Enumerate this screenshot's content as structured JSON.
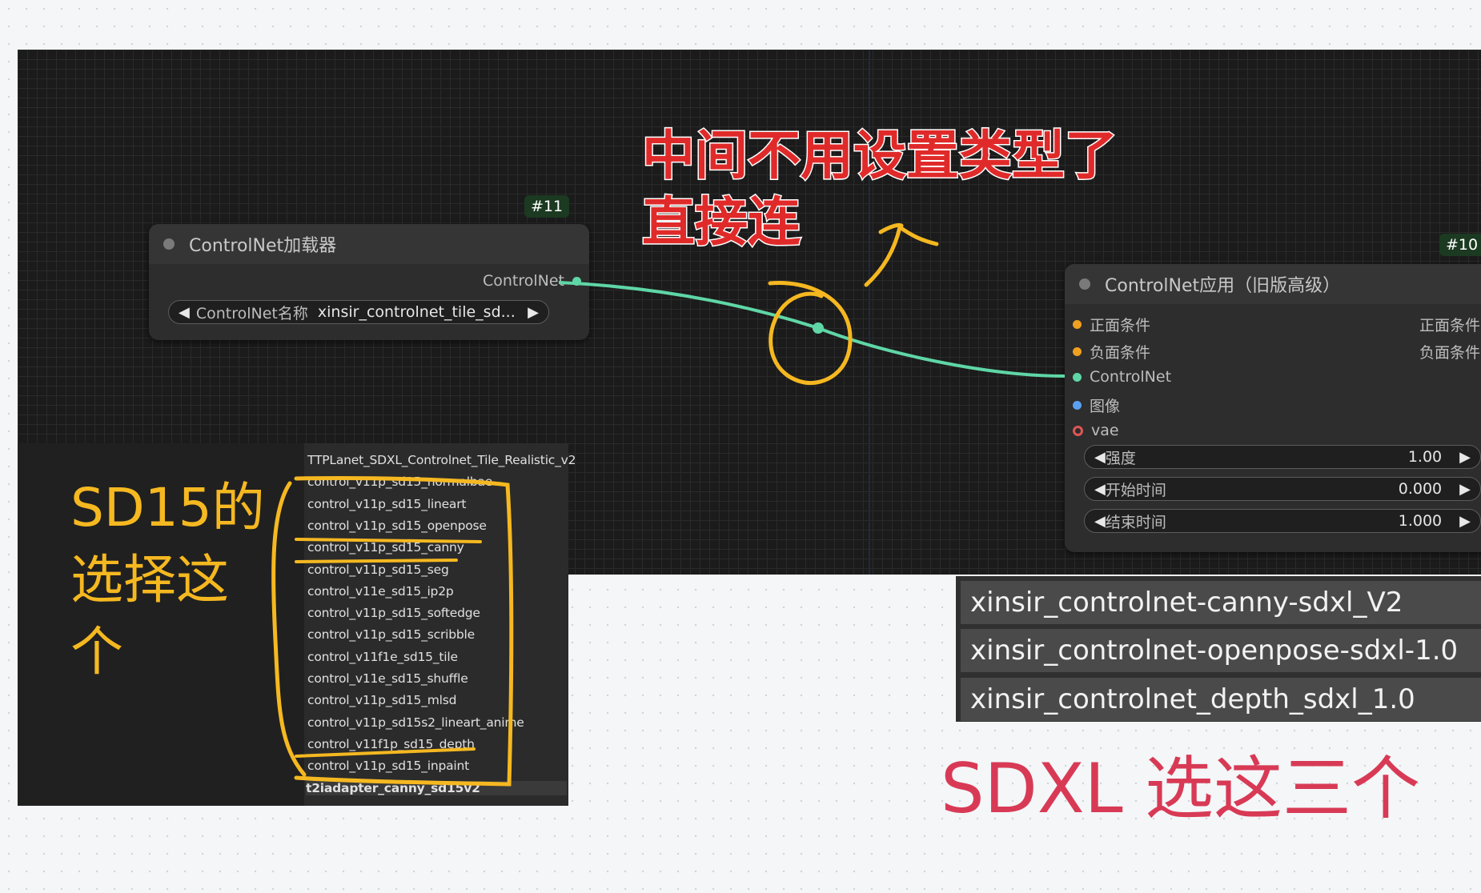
{
  "loader_node": {
    "id_badge": "#11",
    "title": "ControlNet加载器",
    "output_label": "ControlNet",
    "widget_label": "ControlNet名称",
    "widget_value": "xinsir_controlnet_tile_sd..."
  },
  "apply_node": {
    "id_badge": "#10",
    "title": "ControlNet应用（旧版高级）",
    "inputs": [
      "正面条件",
      "负面条件",
      "ControlNet",
      "图像",
      "vae"
    ],
    "outputs": [
      "正面条件",
      "负面条件"
    ],
    "widgets": [
      {
        "label": "强度",
        "value": "1.00"
      },
      {
        "label": "开始时间",
        "value": "0.000"
      },
      {
        "label": "结束时间",
        "value": "1.000"
      }
    ]
  },
  "model_list": [
    "TTPLanet_SDXL_Controlnet_Tile_Realistic_v2",
    "control_v11p_sd15_normalbae",
    "control_v11p_sd15_lineart",
    "control_v11p_sd15_openpose",
    "control_v11p_sd15_canny",
    "control_v11p_sd15_seg",
    "control_v11e_sd15_ip2p",
    "control_v11p_sd15_softedge",
    "control_v11p_sd15_scribble",
    "control_v11f1e_sd15_tile",
    "control_v11e_sd15_shuffle",
    "control_v11p_sd15_mlsd",
    "control_v11p_sd15s2_lineart_anime",
    "control_v11f1p_sd15_depth",
    "control_v11p_sd15_inpaint",
    "t2iadapter_canny_sd15v2"
  ],
  "sdxl_list": [
    "xinsir_controlnet-canny-sdxl_V2",
    "xinsir_controlnet-openpose-sdxl-1.0",
    "xinsir_controlnet_depth_sdxl_1.0"
  ],
  "annotations": {
    "red_line1": "中间不用设置类型了",
    "red_line2": "直接连",
    "sd15_line1": "SD15的",
    "sd15_line2": "选择这",
    "sd15_line3": "个",
    "sdxl": "SDXL 选这三个"
  },
  "colors": {
    "link": "#5fd6a6",
    "annotation_yellow": "#f5b820",
    "annotation_red": "#e02a2a",
    "annotation_pink": "#d83a55",
    "slot_orange": "#f0a020",
    "slot_blue": "#5aa0f0",
    "slot_red": "#e05555"
  }
}
